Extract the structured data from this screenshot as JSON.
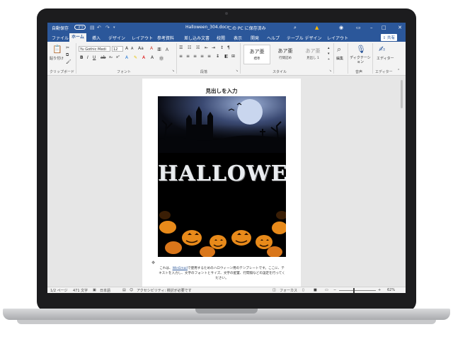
{
  "titlebar": {
    "autosave_label": "自動保存",
    "autosave_state": "オフ",
    "document_title": "Halloween_304.docx",
    "save_status": "この PC に保存済み",
    "search_icon": "search-icon",
    "user_icon": "user-icon"
  },
  "tabs": [
    "ファイル",
    "ホーム",
    "挿入",
    "デザイン",
    "レイアウト",
    "参考資料",
    "差し込み文書",
    "校閲",
    "表示",
    "開発",
    "ヘルプ",
    "テーブル デザイン",
    "レイアウト"
  ],
  "share_label": "共有",
  "ribbon": {
    "clipboard": {
      "paste_label": "貼り付け",
      "group_label": "クリップボード"
    },
    "font": {
      "name": "Yu Gothic Medi",
      "size": "12",
      "group_label": "フォント"
    },
    "paragraph": {
      "group_label": "段落"
    },
    "styles": {
      "group_label": "スタイル",
      "items": [
        {
          "sample": "あア亜",
          "name": "標準"
        },
        {
          "sample": "あア亜",
          "name": "行間詰め"
        },
        {
          "sample": "あア亜",
          "name": "見出し 1"
        }
      ]
    },
    "editing": {
      "label": "編集"
    },
    "voice": {
      "dictate_label": "ディクテーション",
      "group_label": "音声"
    },
    "editor": {
      "label": "エディター",
      "group_label": "エディター"
    }
  },
  "document": {
    "heading": "見出しを入力",
    "poster_title": "HALLOWEEN",
    "body_prefix": "これは、",
    "body_link": "WinEmail",
    "body_rest": "で使用するためのハロウィーン用のテンプレートです。ここに、テキストを入力し、文字のフォントとサイズ、文字の配置、行間隔などの設定を行ってください。"
  },
  "statusbar": {
    "page": "1/2 ページ",
    "words": "471 文字",
    "language": "日本語",
    "accessibility": "アクセシビリティ: 検討が必要です",
    "focus": "フォーカス",
    "zoom": "62%"
  },
  "colors": {
    "word_blue": "#2b579a",
    "poster_moon": "#c9d6ee",
    "pumpkin": "#e88a1a"
  }
}
